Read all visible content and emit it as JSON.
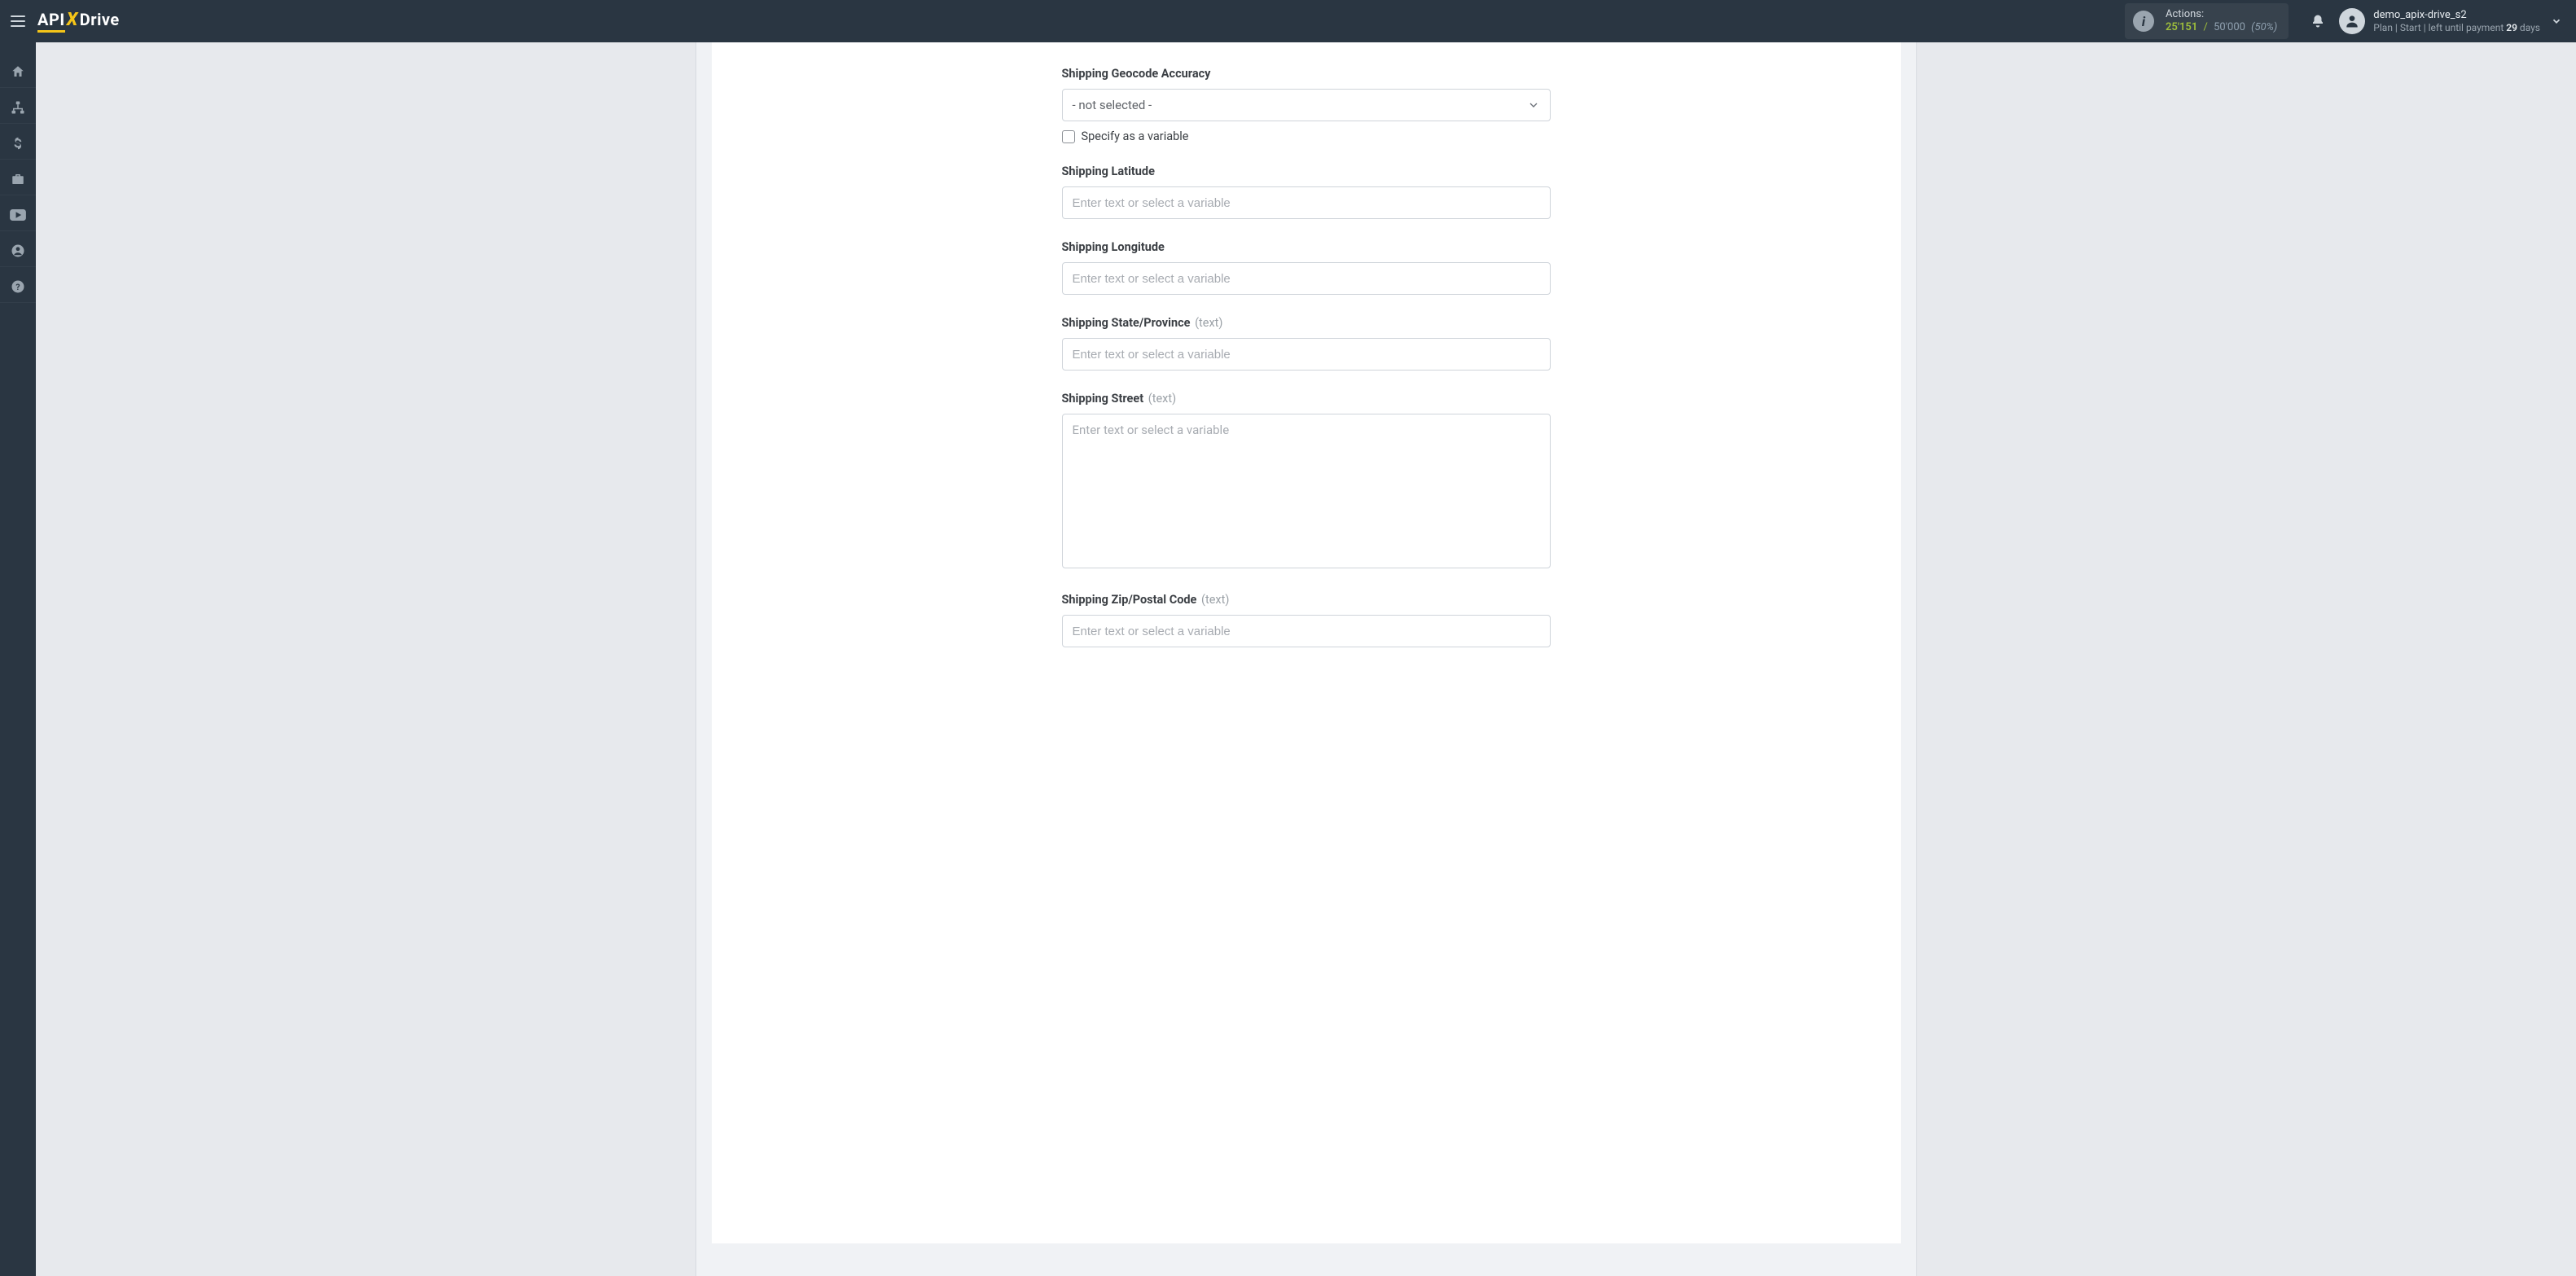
{
  "header": {
    "logo": {
      "part1": "API",
      "part2": "X",
      "part3": "Drive"
    },
    "actions": {
      "label": "Actions:",
      "used": "25'151",
      "limit": "50'000",
      "percent": "(50%)"
    },
    "user": {
      "name": "demo_apix-drive_s2",
      "plan_prefix": "Plan |",
      "plan_name": "Start",
      "plan_mid": "| left until payment ",
      "days": "29",
      "days_suffix": " days"
    }
  },
  "sidebar_icons": [
    "home",
    "sitemap",
    "dollar",
    "briefcase",
    "youtube",
    "user",
    "help"
  ],
  "form": {
    "placeholder_text": "Enter text or select a variable",
    "not_selected": "- not selected -",
    "specify_variable": "Specify as a variable",
    "text_hint": "(text)",
    "fields": {
      "geocode_label": "Shipping Geocode Accuracy",
      "latitude_label": "Shipping Latitude",
      "longitude_label": "Shipping Longitude",
      "state_label": "Shipping State/Province",
      "street_label": "Shipping Street",
      "zip_label": "Shipping Zip/Postal Code"
    }
  }
}
